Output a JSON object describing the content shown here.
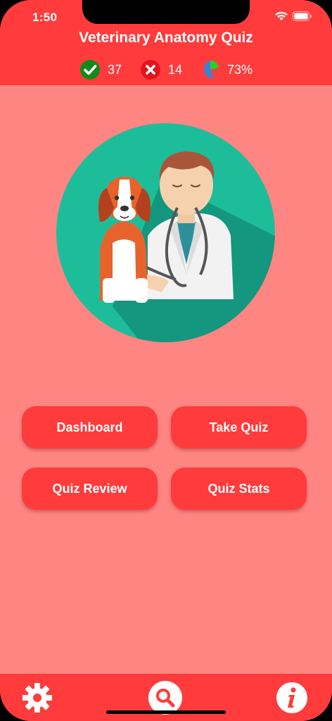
{
  "status_bar": {
    "time": "1:50"
  },
  "header": {
    "title": "Veterinary Anatomy Quiz",
    "correct_count": "37",
    "wrong_count": "14",
    "score_percent": "73%"
  },
  "menu": {
    "dashboard_label": "Dashboard",
    "take_quiz_label": "Take Quiz",
    "quiz_review_label": "Quiz Review",
    "quiz_stats_label": "Quiz Stats"
  },
  "tabbar": {
    "icons": [
      "gear-icon",
      "search-icon",
      "info-icon"
    ]
  },
  "colors": {
    "primary": "#FF3B3C",
    "background": "#FF8583",
    "hero_circle": "#1EBD9A"
  }
}
